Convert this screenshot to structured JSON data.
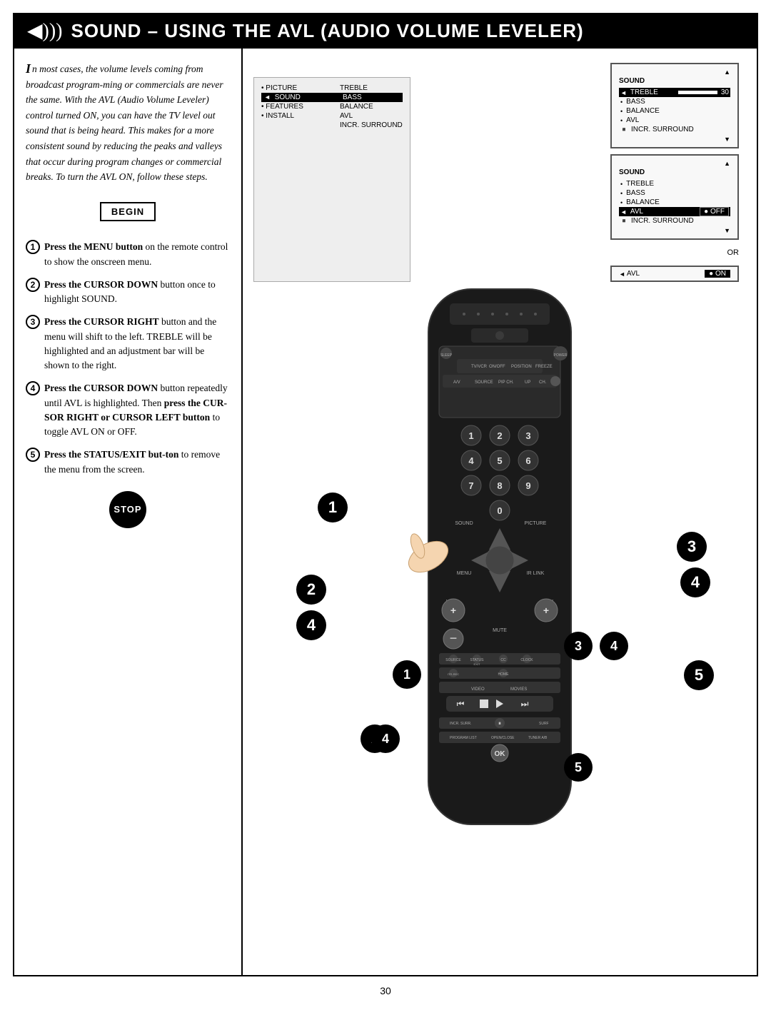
{
  "header": {
    "icon": "◀",
    "sound_icon": "◀))",
    "title": "Sound – Using the AVL (Audio Volume Leveler)"
  },
  "intro": {
    "text": "n most cases, the volume levels coming from broadcast program-ming or commercials are never the same. With the AVL (Audio Volume Leveler) control turned ON, you can have the TV level out sound that is being heard. This makes for a more consistent sound by reducing the peaks and valleys that occur during program changes or commercial breaks. To turn the AVL ON, follow these steps.",
    "dropcap": "I"
  },
  "begin_label": "BEGIN",
  "steps": [
    {
      "num": "1",
      "text_bold": "Press the MENU button",
      "text": " on the remote control to show the onscreen menu."
    },
    {
      "num": "2",
      "text_bold": "Press the CURSOR DOWN",
      "text": " button once to highlight SOUND."
    },
    {
      "num": "3",
      "text_bold": "Press the CURSOR RIGHT",
      "text": " button and the menu will shift to the left. TREBLE will be highlighted and an adjustment bar will be shown to the right."
    },
    {
      "num": "4",
      "text_bold": "Press the CURSOR DOWN",
      "text": " button repeatedly until AVL is highlighted. Then press the CURSOR RIGHT or CURSOR LEFT button to toggle AVL ON or OFF."
    },
    {
      "num": "5",
      "text_bold": "Press the STATUS/EXIT but-",
      "text": "ton to remove the menu from the screen."
    }
  ],
  "stop_label": "STOP",
  "main_menu": {
    "items_left": [
      "PICTURE",
      "SOUND",
      "FEATURES",
      "INSTALL"
    ],
    "items_right": [
      "TREBLE",
      "BASS",
      "BALANCE",
      "AVL",
      "INCR. SURROUND"
    ]
  },
  "sound_menu_treble": {
    "title": "SOUND",
    "items": [
      "TREBLE",
      "BASS",
      "BALANCE",
      "AVL",
      "INCR. SURROUND"
    ],
    "highlighted": "TREBLE",
    "treble_value": "30"
  },
  "sound_menu_avl_off": {
    "title": "SOUND",
    "items": [
      "TREBLE",
      "BASS",
      "BALANCE",
      "AVL",
      "INCR. SURROUND"
    ],
    "highlighted": "AVL",
    "avl_value": "OFF"
  },
  "sound_menu_avl_on": {
    "avl_label": "AVL",
    "avl_value": "ON"
  },
  "or_label": "OR",
  "page_number": "30"
}
